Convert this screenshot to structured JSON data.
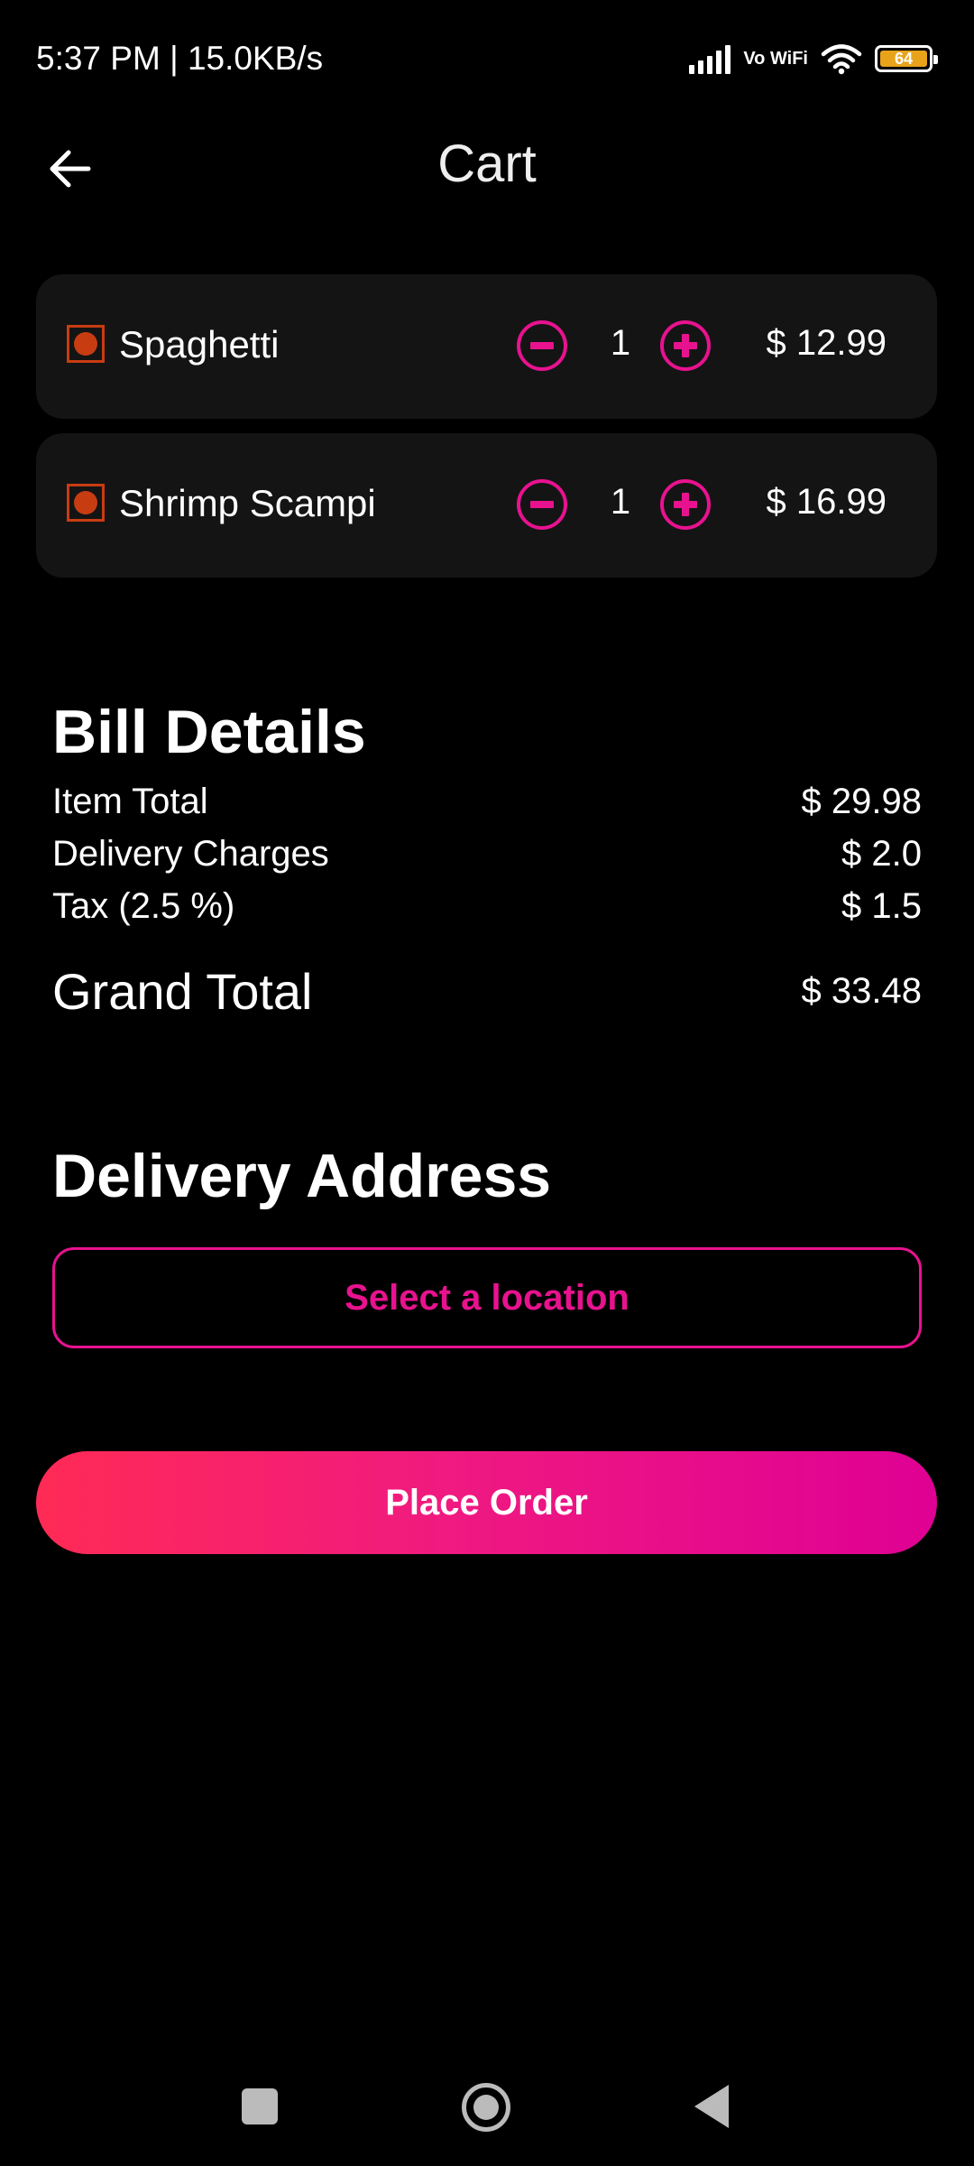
{
  "status_bar": {
    "time": "5:37 PM | 15.0KB/s",
    "network_label": "Vo WiFi",
    "battery_level": "64"
  },
  "app_bar": {
    "title": "Cart",
    "back_icon": "arrow-left-icon"
  },
  "cart": {
    "items": [
      {
        "name": "Spaghetti",
        "quantity": "1",
        "price": "$ 12.99"
      },
      {
        "name": "Shrimp Scampi",
        "quantity": "1",
        "price": "$ 16.99"
      }
    ]
  },
  "bill": {
    "title": "Bill Details",
    "rows": [
      {
        "label": "Item Total",
        "value": "$ 29.98"
      },
      {
        "label": "Delivery Charges",
        "value": "$ 2.0"
      },
      {
        "label": "Tax (2.5 %)",
        "value": "$ 1.5"
      }
    ],
    "grand_total": {
      "label": "Grand Total",
      "value": "$ 33.48"
    }
  },
  "address": {
    "title": "Delivery Address",
    "select_label": "Select a location"
  },
  "order": {
    "button_label": "Place Order"
  },
  "colors": {
    "accent": "#e8128f",
    "gradient_start": "#ff2a55",
    "gradient_end": "#df0094",
    "veg_mark": "#c83c12",
    "card_bg": "#141414",
    "background": "#000000"
  }
}
